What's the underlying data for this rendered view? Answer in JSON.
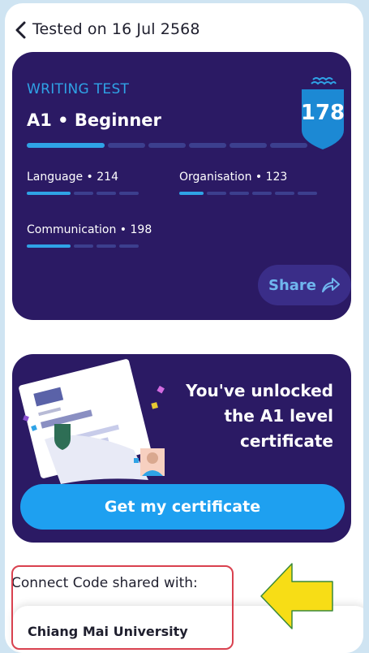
{
  "header": {
    "title": "Tested on 16 Jul 2568"
  },
  "result": {
    "test_type": "WRITING TEST",
    "level": "A1 • Beginner",
    "score": "178",
    "overall_progress": 0.36,
    "skills": [
      {
        "label": "Language • 214",
        "progress": 0.35
      },
      {
        "label": "Organisation • 123",
        "progress": 0.18
      },
      {
        "label": "Communication • 198",
        "progress": 0.32
      }
    ],
    "share_label": "Share"
  },
  "certificate": {
    "line1": "You've unlocked",
    "line2": "the A1 level",
    "line3": "certificate",
    "button_label": "Get my certificate"
  },
  "connect": {
    "label": "Connect Code shared with:",
    "institution": "Chiang Mai University"
  },
  "colors": {
    "card_bg": "#2b1a64",
    "accent_blue": "#2fa3e6",
    "button_blue": "#1ea0f0",
    "highlight_red": "#d9414f",
    "arrow_yellow": "#f7dd16"
  },
  "icons": [
    "chevron-left-icon",
    "shield-badge-icon",
    "share-arrow-icon",
    "arrow-left-icon"
  ]
}
